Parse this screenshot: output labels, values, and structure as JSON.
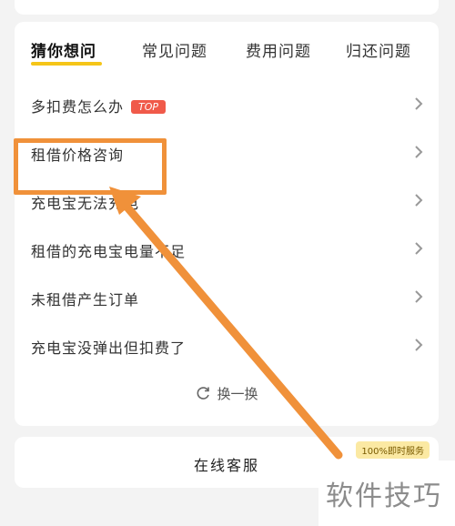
{
  "tabs": [
    {
      "label": "猜你想问",
      "active": true
    },
    {
      "label": "常见问题",
      "active": false
    },
    {
      "label": "费用问题",
      "active": false
    },
    {
      "label": "归还问题",
      "active": false
    }
  ],
  "questions": [
    {
      "label": "多扣费怎么办",
      "badge": "TOP"
    },
    {
      "label": "租借价格咨询"
    },
    {
      "label": "充电宝无法充电"
    },
    {
      "label": "租借的充电宝电量不足"
    },
    {
      "label": "未租借产生订单"
    },
    {
      "label": "充电宝没弹出但扣费了"
    }
  ],
  "refresh_label": "换一换",
  "online_service": {
    "label": "在线客服",
    "badge": "100%即时服务"
  },
  "watermark": "软件技巧",
  "colors": {
    "accent_yellow": "#f5c518",
    "highlight_orange": "#f0913a",
    "top_badge_red": "#f05a4a"
  },
  "icons": {
    "row_chevron": "chevron-right-icon",
    "refresh": "refresh-icon"
  }
}
